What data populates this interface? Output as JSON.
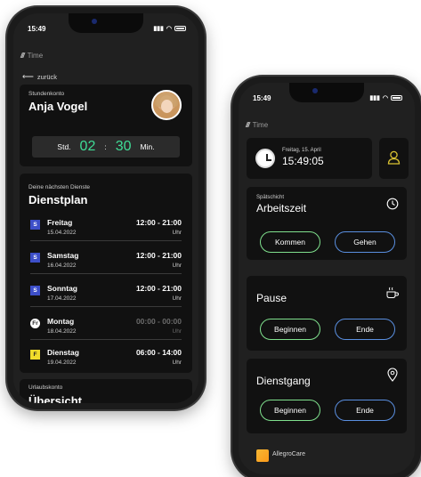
{
  "colors": {
    "accent_green": "#3fdc96",
    "button_green": "#7fe08d",
    "button_blue": "#5a8fe0",
    "badge_s": "#3d4fc9",
    "badge_f": "#f0dc2b",
    "user_icon": "#d9c232"
  },
  "phone_a": {
    "status": {
      "time": "15:49"
    },
    "app_title": "Time",
    "back_label": "zurück",
    "account": {
      "label": "Stundenkonto",
      "name": "Anja Vogel"
    },
    "hours": {
      "prefix": "Std.",
      "hours": "02",
      "separator": ":",
      "minutes": "30",
      "suffix": "Min."
    },
    "schedule": {
      "label": "Deine nächsten Dienste",
      "title": "Dienstplan",
      "items": [
        {
          "badge": "S",
          "day": "Freitag",
          "date": "15.04.2022",
          "time": "12:00 - 21:00",
          "unit": "Uhr"
        },
        {
          "badge": "S",
          "day": "Samstag",
          "date": "16.04.2022",
          "time": "12:00 - 21:00",
          "unit": "Uhr"
        },
        {
          "badge": "S",
          "day": "Sonntag",
          "date": "17.04.2022",
          "time": "12:00 - 21:00",
          "unit": "Uhr"
        },
        {
          "badge": "Fr",
          "day": "Montag",
          "date": "18.04.2022",
          "time": "00:00 - 00:00",
          "unit": "Uhr"
        },
        {
          "badge": "F",
          "day": "Dienstag",
          "date": "19.04.2022",
          "time": "06:00 - 14:00",
          "unit": "Uhr"
        }
      ]
    },
    "vacation": {
      "label": "Urlaubskonto",
      "title": "Übersicht"
    }
  },
  "phone_b": {
    "status": {
      "time": "15:49"
    },
    "app_title": "Time",
    "datetime": {
      "date": "Freitag, 15. April",
      "time": "15:49:05"
    },
    "worktime": {
      "label": "Spätschicht",
      "title": "Arbeitszeit",
      "btn_in": "Kommen",
      "btn_out": "Gehen"
    },
    "pause": {
      "title": "Pause",
      "btn_start": "Beginnen",
      "btn_end": "Ende"
    },
    "errand": {
      "title": "Dienstgang",
      "btn_start": "Beginnen",
      "btn_end": "Ende"
    },
    "brand": "AllegroCare"
  }
}
